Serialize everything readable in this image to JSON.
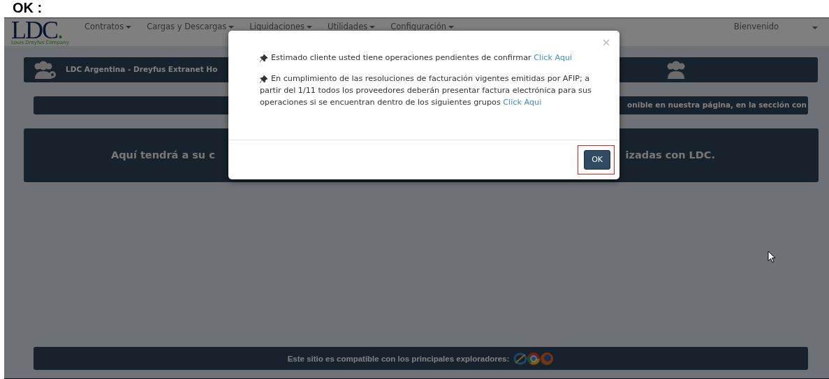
{
  "caption": "OK :",
  "navbar": {
    "logo": "LDC",
    "logo_dot": ".",
    "tagline": "Louis Dreyfus Company",
    "menus": [
      {
        "label": "Contratos"
      },
      {
        "label": "Cargas y Descargas"
      },
      {
        "label": "Liquidaciones"
      },
      {
        "label": "Utilidades"
      },
      {
        "label": "Configuración"
      }
    ],
    "user": "Bienvenido"
  },
  "panels": {
    "header_title": "LDC Argentina - Dreyfus Extranet Ho",
    "notice": "onible en nuestra página, en la sección con",
    "welcome_left": "Aquí tendrá a su c",
    "welcome_right": "izadas con LDC."
  },
  "footer": {
    "text": "Este sitio es compatible con los principales exploradores:"
  },
  "modal": {
    "messages": [
      {
        "text": "Estimado cliente usted tiene operaciones pendientes de confirmar",
        "link": "Click Aqui"
      },
      {
        "text": "En cumplimiento de las resoluciones de facturación vigentes emitidas por AFIP; a partir del 1/11 todos los proveedores deberán presentar factura electrónica para sus operaciones si se encuentran dentro de los siguientes grupos",
        "link": "Click Aqui"
      }
    ],
    "button": "OK",
    "button_highlighted": true
  }
}
